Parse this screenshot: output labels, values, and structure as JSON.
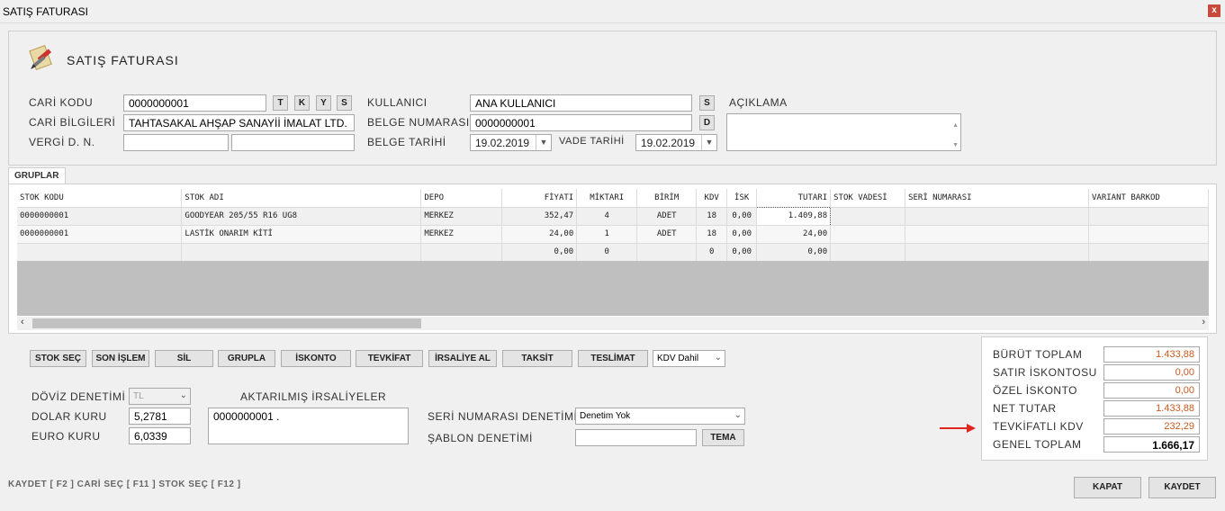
{
  "window": {
    "title": "SATIŞ FATURASI",
    "close": "x"
  },
  "form": {
    "title": "SATIŞ FATURASI",
    "cari_kodu_label": "CARİ KODU",
    "cari_kodu_value": "0000000001",
    "cari_buttons": [
      "T",
      "K",
      "Y",
      "S"
    ],
    "cari_bilgileri_label": "CARİ BİLGİLERİ",
    "cari_bilgileri_value": "TAHTASAKAL AHŞAP SANAYİİ İMALAT LTD.",
    "vergi_label": "VERGİ D. N.",
    "vergi_value1": "",
    "vergi_value2": "",
    "kullanici_label": "KULLANICI",
    "kullanici_value": "ANA KULLANICI",
    "kullanici_btn": "S",
    "belge_no_label": "BELGE NUMARASI",
    "belge_no_value": "0000000001",
    "belge_no_btn": "D",
    "belge_tarihi_label": "BELGE TARİHİ",
    "belge_tarihi_value": "19.02.2019",
    "vade_tarihi_label": "VADE TARİHİ",
    "vade_tarihi_value": "19.02.2019",
    "aciklama_label": "AÇIKLAMA",
    "aciklama_value": ""
  },
  "tab": {
    "label": "GRUPLAR"
  },
  "grid": {
    "columns": [
      "STOK KODU",
      "STOK ADI",
      "DEPO",
      "FİYATI",
      "MİKTARI",
      "BİRİM",
      "KDV",
      "İSK",
      "TUTARI",
      "STOK VADESİ",
      "SERİ NUMARASI",
      "VARIANT BARKOD"
    ],
    "rows": [
      [
        "0000000001",
        "GOODYEAR 205/55 R16 UG8",
        "MERKEZ",
        "352,47",
        "4",
        "ADET",
        "18",
        "0,00",
        "1.409,88",
        "",
        "",
        ""
      ],
      [
        "0000000001",
        "LASTİK ONARIM KİTİ",
        "MERKEZ",
        "24,00",
        "1",
        "ADET",
        "18",
        "0,00",
        "24,00",
        "",
        "",
        ""
      ],
      [
        "",
        "",
        "",
        "0,00",
        "0",
        "",
        "0",
        "0,00",
        "0,00",
        "",
        "",
        ""
      ]
    ]
  },
  "actions": {
    "stok_sec": "STOK SEÇ",
    "son_islem": "SON İŞLEM",
    "sil": "SİL",
    "grupla": "GRUPLA",
    "iskonto": "İSKONTO",
    "tevkifat": "TEVKİFAT",
    "irsaliye_al": "İRSALİYE AL",
    "taksit": "TAKSİT",
    "teslimat": "TESLİMAT",
    "kdv_select": "KDV Dahil"
  },
  "currency": {
    "doviz_label": "DÖVİZ DENETİMİ",
    "doviz_value": "TL",
    "dolar_label": "DOLAR KURU",
    "dolar_value": "5,2781",
    "euro_label": "EURO KURU",
    "euro_value": "6,0339"
  },
  "irsaliye": {
    "label": "AKTARILMIŞ İRSALİYELER",
    "value": "0000000001 ."
  },
  "seri": {
    "label": "SERİ NUMARASI DENETİMİ",
    "value": "Denetim Yok",
    "sablon_label": "ŞABLON DENETİMİ",
    "sablon_value": "",
    "tema_btn": "TEMA"
  },
  "totals": {
    "items": [
      {
        "label": "BÜRÜT TOPLAM",
        "value": "1.433,88"
      },
      {
        "label": "SATIR İSKONTOSU",
        "value": "0,00"
      },
      {
        "label": "ÖZEL İSKONTO",
        "value": "0,00"
      },
      {
        "label": "NET TUTAR",
        "value": "1.433,88"
      },
      {
        "label": "TEVKİFATLI KDV",
        "value": "232,29"
      },
      {
        "label": "GENEL TOPLAM",
        "value": "1.666,17"
      }
    ],
    "value_color": "#c85a20",
    "arrow_color": "#e0251f"
  },
  "footer": {
    "shortcuts": "KAYDET [ F2 ]  CARİ SEÇ [ F11 ] STOK SEÇ [ F12 ]",
    "kapat": "KAPAT",
    "kaydet": "KAYDET"
  }
}
